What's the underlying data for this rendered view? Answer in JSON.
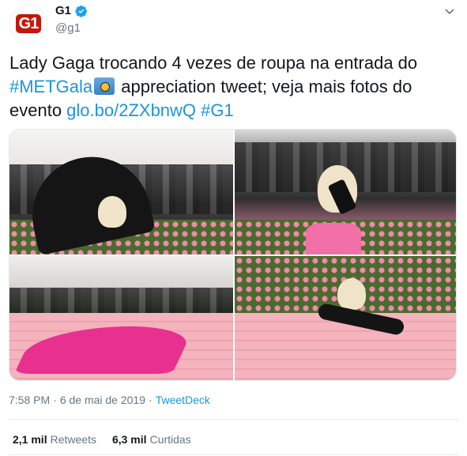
{
  "account": {
    "avatar_text": "G1",
    "display_name": "G1",
    "handle": "@g1",
    "verified": true,
    "brand_color": "#c4170c"
  },
  "tweet": {
    "text_part1": "Lady Gaga trocando 4 vezes de roupa na entrada do ",
    "hashtag_metgala": "#METGala",
    "emoji": "camera-emoji",
    "text_part2": " appreciation tweet; veja mais fotos do evento ",
    "link": "glo.bo/2ZXbnwQ",
    "hashtag_g1": "#G1"
  },
  "media": {
    "photos": [
      {
        "subject": "umbrella-photo"
      },
      {
        "subject": "phone-photo"
      },
      {
        "subject": "pink-gown-photo"
      },
      {
        "subject": "lingerie-photo"
      }
    ]
  },
  "meta": {
    "time": "7:58 PM",
    "separator": "·",
    "date": "6 de mai de 2019",
    "separator2": "·",
    "source": "TweetDeck"
  },
  "stats": {
    "retweets_count": "2,1 mil",
    "retweets_label": "Retweets",
    "likes_count": "6,3 mil",
    "likes_label": "Curtidas"
  },
  "colors": {
    "link": "#1b95e0",
    "secondary_text": "#657786",
    "primary_text": "#14171a",
    "divider": "#e6ecf0"
  }
}
